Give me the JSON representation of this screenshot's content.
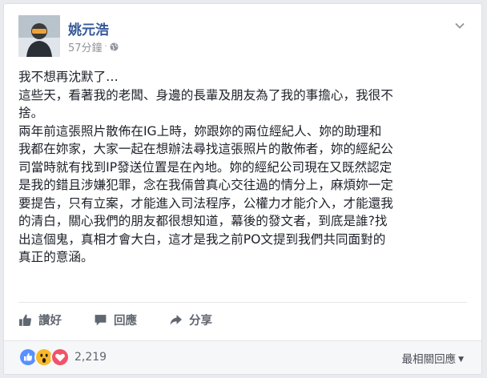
{
  "post": {
    "author": "姚元浩",
    "time": "57分鐘",
    "separator": "·",
    "privacy_icon": "globe-icon",
    "menu_icon": "chevron-down-icon",
    "text_lines": [
      "我不想再沈默了…",
      "這些天，看著我的老闆、身邊的長輩及朋友為了我的事擔心，我很不",
      "捨。",
      "兩年前這張照片散佈在IG上時，妳跟妳的兩位經紀人、妳的助理和",
      "我都在妳家，大家一起在想辦法尋找這張照片的散佈者，妳的經紀公",
      "司當時就有找到IP發送位置是在內地。妳的經紀公司現在又既然認定",
      "是我的錯且涉嫌犯罪，念在我倆曾真心交往過的情分上，麻煩妳一定",
      "要提告，只有立案，才能進入司法程序，公權力才能介入，才能還我",
      "的清白，關心我們的朋友都很想知道，幕後的發文者，到底是誰?找",
      "出這個鬼，真相才會大白，這才是我之前PO文提到我們共同面對的",
      "真正的意涵。"
    ]
  },
  "actions": {
    "like_label": "讚好",
    "comment_label": "回應",
    "share_label": "分享"
  },
  "footer": {
    "reaction_count": "2,219",
    "sort_label": "最相關回應",
    "sort_caret": "▼",
    "reaction_icons": [
      "like-reaction-icon",
      "wow-reaction-icon",
      "love-reaction-icon"
    ]
  },
  "colors": {
    "author_link": "#365899",
    "meta_gray": "#90949c",
    "action_gray": "#606770",
    "like_blue": "#5890ff",
    "wow_yellow": "#f7b928",
    "love_red": "#f25268"
  }
}
